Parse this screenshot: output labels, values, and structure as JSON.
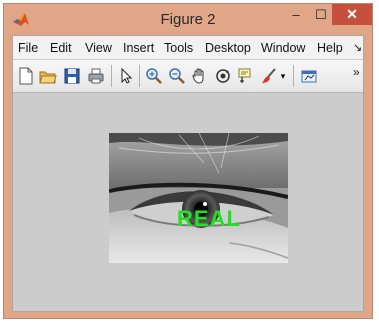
{
  "window": {
    "title": "Figure 2",
    "minimize_glyph": "–",
    "maximize_glyph": "☐",
    "close_glyph": "✕",
    "close_color": "#c7503c",
    "frame_color": "#e0a687"
  },
  "menubar": {
    "items": [
      "File",
      "Edit",
      "View",
      "Insert",
      "Tools",
      "Desktop",
      "Window",
      "Help"
    ],
    "overflow_glyph": "↘"
  },
  "toolbar": {
    "icons": [
      "new-figure-icon",
      "open-file-icon",
      "save-icon",
      "print-icon",
      "pointer-icon",
      "zoom-in-icon",
      "zoom-out-icon",
      "pan-icon",
      "rotate-3d-icon",
      "data-cursor-icon",
      "brush-icon",
      "brush-dropdown-icon",
      "link-plot-icon"
    ],
    "overflow_glyph": "»"
  },
  "figure": {
    "image": "grayscale eye close-up",
    "overlay_text": "REAL",
    "overlay_color": "#22e022",
    "background_color": "#cccccc"
  }
}
